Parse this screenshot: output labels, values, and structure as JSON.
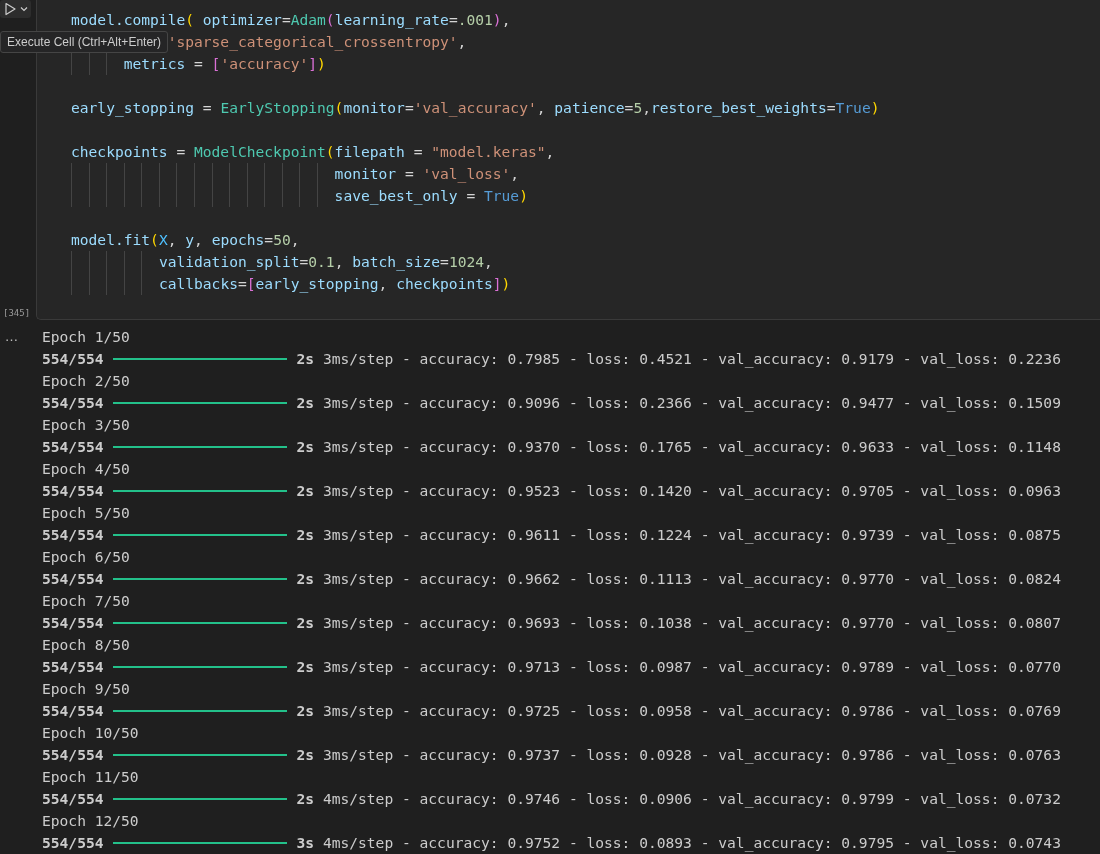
{
  "run_button": {
    "tooltip": "Execute Cell (Ctrl+Alt+Enter)"
  },
  "cell": {
    "execution_count": "[345]",
    "code_lines": [
      {
        "kind": "code",
        "tokens": [
          {
            "kind": "var",
            "text": "model.compile"
          },
          {
            "kind": "p1",
            "text": "("
          },
          {
            "kind": "var",
            "text": " optimizer"
          },
          {
            "kind": "plain",
            "text": "="
          },
          {
            "kind": "cls",
            "text": "Adam"
          },
          {
            "kind": "p2",
            "text": "("
          },
          {
            "kind": "var",
            "text": "learning_rate"
          },
          {
            "kind": "plain",
            "text": "="
          },
          {
            "kind": "num",
            "text": ".001"
          },
          {
            "kind": "p2",
            "text": ")"
          },
          {
            "kind": "plain",
            "text": ","
          }
        ]
      },
      {
        "kind": "code",
        "tokens": [
          {
            "kind": "str",
            "text": "           'sparse_categorical_crossentropy'"
          },
          {
            "kind": "plain",
            "text": ","
          }
        ]
      },
      {
        "kind": "code",
        "tokens": [
          {
            "kind": "var",
            "text": "      metrics"
          },
          {
            "kind": "plain",
            "text": " = "
          },
          {
            "kind": "p2",
            "text": "["
          },
          {
            "kind": "str",
            "text": "'accuracy'"
          },
          {
            "kind": "p2",
            "text": "]"
          },
          {
            "kind": "p1",
            "text": ")"
          }
        ]
      },
      {
        "kind": "blank"
      },
      {
        "kind": "code",
        "tokens": [
          {
            "kind": "var",
            "text": "early_stopping"
          },
          {
            "kind": "plain",
            "text": " = "
          },
          {
            "kind": "cls",
            "text": "EarlyStopping"
          },
          {
            "kind": "p1",
            "text": "("
          },
          {
            "kind": "var",
            "text": "monitor"
          },
          {
            "kind": "plain",
            "text": "="
          },
          {
            "kind": "str",
            "text": "'val_accuracy'"
          },
          {
            "kind": "plain",
            "text": ", "
          },
          {
            "kind": "var",
            "text": "patience"
          },
          {
            "kind": "plain",
            "text": "="
          },
          {
            "kind": "num",
            "text": "5"
          },
          {
            "kind": "plain",
            "text": ","
          },
          {
            "kind": "var",
            "text": "restore_best_weights"
          },
          {
            "kind": "plain",
            "text": "="
          },
          {
            "kind": "kw",
            "text": "True"
          },
          {
            "kind": "p1",
            "text": ")"
          }
        ]
      },
      {
        "kind": "blank"
      },
      {
        "kind": "code",
        "tokens": [
          {
            "kind": "var",
            "text": "checkpoints"
          },
          {
            "kind": "plain",
            "text": " = "
          },
          {
            "kind": "cls",
            "text": "ModelCheckpoint"
          },
          {
            "kind": "p1",
            "text": "("
          },
          {
            "kind": "var",
            "text": "filepath"
          },
          {
            "kind": "plain",
            "text": " = "
          },
          {
            "kind": "str",
            "text": "\"model.keras\""
          },
          {
            "kind": "plain",
            "text": ","
          }
        ]
      },
      {
        "kind": "code",
        "tokens": [
          {
            "kind": "var",
            "text": "                              monitor"
          },
          {
            "kind": "plain",
            "text": " = "
          },
          {
            "kind": "str",
            "text": "'val_loss'"
          },
          {
            "kind": "plain",
            "text": ","
          }
        ]
      },
      {
        "kind": "code",
        "tokens": [
          {
            "kind": "var",
            "text": "                              save_best_only"
          },
          {
            "kind": "plain",
            "text": " = "
          },
          {
            "kind": "kw",
            "text": "True"
          },
          {
            "kind": "p1",
            "text": ")"
          }
        ]
      },
      {
        "kind": "blank"
      },
      {
        "kind": "code",
        "tokens": [
          {
            "kind": "var",
            "text": "model.fit"
          },
          {
            "kind": "p1",
            "text": "("
          },
          {
            "kind": "const",
            "text": "X"
          },
          {
            "kind": "plain",
            "text": ", "
          },
          {
            "kind": "var",
            "text": "y"
          },
          {
            "kind": "plain",
            "text": ", "
          },
          {
            "kind": "var",
            "text": "epochs"
          },
          {
            "kind": "plain",
            "text": "="
          },
          {
            "kind": "num",
            "text": "50"
          },
          {
            "kind": "plain",
            "text": ","
          }
        ]
      },
      {
        "kind": "code",
        "tokens": [
          {
            "kind": "var",
            "text": "          validation_split"
          },
          {
            "kind": "plain",
            "text": "="
          },
          {
            "kind": "num",
            "text": "0.1"
          },
          {
            "kind": "plain",
            "text": ", "
          },
          {
            "kind": "var",
            "text": "batch_size"
          },
          {
            "kind": "plain",
            "text": "="
          },
          {
            "kind": "num",
            "text": "1024"
          },
          {
            "kind": "plain",
            "text": ","
          }
        ]
      },
      {
        "kind": "code",
        "tokens": [
          {
            "kind": "var",
            "text": "          callbacks"
          },
          {
            "kind": "plain",
            "text": "="
          },
          {
            "kind": "p2",
            "text": "["
          },
          {
            "kind": "var",
            "text": "early_stopping"
          },
          {
            "kind": "plain",
            "text": ", "
          },
          {
            "kind": "var",
            "text": "checkpoints"
          },
          {
            "kind": "p2",
            "text": "]"
          },
          {
            "kind": "p1",
            "text": ")"
          }
        ]
      }
    ]
  },
  "output": {
    "menu": "…",
    "epochs": [
      {
        "label": "Epoch 1/50",
        "steps": "554/554",
        "level": 1,
        "time": "2s",
        "metrics": "3ms/step - accuracy: 0.7985 - loss: 0.4521 - val_accuracy: 0.9179 - val_loss: 0.2236"
      },
      {
        "label": "Epoch 2/50",
        "steps": "554/554",
        "level": 1,
        "time": "2s",
        "metrics": "3ms/step - accuracy: 0.9096 - loss: 0.2366 - val_accuracy: 0.9477 - val_loss: 0.1509"
      },
      {
        "label": "Epoch 3/50",
        "steps": "554/554",
        "level": 1,
        "time": "2s",
        "metrics": "3ms/step - accuracy: 0.9370 - loss: 0.1765 - val_accuracy: 0.9633 - val_loss: 0.1148"
      },
      {
        "label": "Epoch 4/50",
        "steps": "554/554",
        "level": 1,
        "time": "2s",
        "metrics": "3ms/step - accuracy: 0.9523 - loss: 0.1420 - val_accuracy: 0.9705 - val_loss: 0.0963"
      },
      {
        "label": "Epoch 5/50",
        "steps": "554/554",
        "level": 1,
        "time": "2s",
        "metrics": "3ms/step - accuracy: 0.9611 - loss: 0.1224 - val_accuracy: 0.9739 - val_loss: 0.0875"
      },
      {
        "label": "Epoch 6/50",
        "steps": "554/554",
        "level": 1,
        "time": "2s",
        "metrics": "3ms/step - accuracy: 0.9662 - loss: 0.1113 - val_accuracy: 0.9770 - val_loss: 0.0824"
      },
      {
        "label": "Epoch 7/50",
        "steps": "554/554",
        "level": 1,
        "time": "2s",
        "metrics": "3ms/step - accuracy: 0.9693 - loss: 0.1038 - val_accuracy: 0.9770 - val_loss: 0.0807"
      },
      {
        "label": "Epoch 8/50",
        "steps": "554/554",
        "level": 1,
        "time": "2s",
        "metrics": "3ms/step - accuracy: 0.9713 - loss: 0.0987 - val_accuracy: 0.9789 - val_loss: 0.0770"
      },
      {
        "label": "Epoch 9/50",
        "steps": "554/554",
        "level": 1,
        "time": "2s",
        "metrics": "3ms/step - accuracy: 0.9725 - loss: 0.0958 - val_accuracy: 0.9786 - val_loss: 0.0769"
      },
      {
        "label": "Epoch 10/50",
        "steps": "554/554",
        "level": 1,
        "time": "2s",
        "metrics": "3ms/step - accuracy: 0.9737 - loss: 0.0928 - val_accuracy: 0.9786 - val_loss: 0.0763"
      },
      {
        "label": "Epoch 11/50",
        "steps": "554/554",
        "level": 1,
        "time": "2s",
        "metrics": "4ms/step - accuracy: 0.9746 - loss: 0.0906 - val_accuracy: 0.9799 - val_loss: 0.0732"
      },
      {
        "label": "Epoch 12/50",
        "steps": "554/554",
        "level": 1,
        "time": "3s",
        "metrics": "4ms/step - accuracy: 0.9752 - loss: 0.0893 - val_accuracy: 0.9795 - val_loss: 0.0743"
      }
    ]
  }
}
